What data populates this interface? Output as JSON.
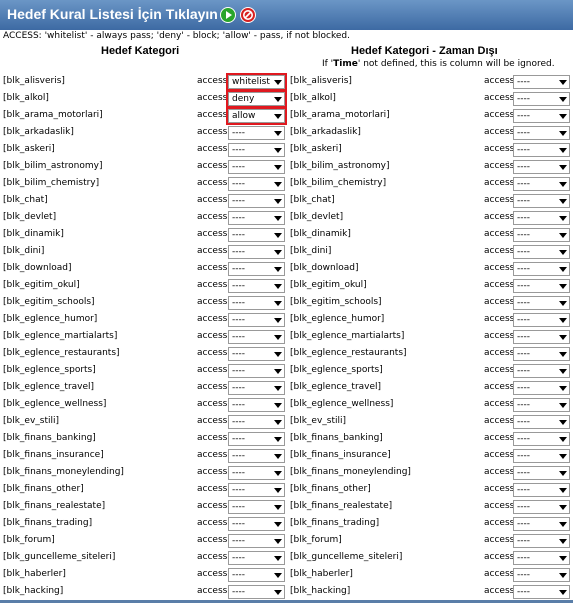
{
  "header": {
    "title": "Hedef Kural Listesi İçin Tıklayın",
    "play_icon": "play-icon",
    "stop_icon": "stop-icon",
    "accent": "#4a78b0"
  },
  "access_note": "ACCESS: 'whitelist' - always pass; 'deny' - block; 'allow' - pass, if not blocked.",
  "left_heading": "Hedef Kategori",
  "right_heading": "Hedef Kategori - Zaman Dışı",
  "right_note": {
    "prefix": "If '",
    "bold": "Time",
    "suffix": "' not defined, this is column will be ignored."
  },
  "access_label": "access",
  "rows": [
    {
      "cat": "[blk_alisveris]",
      "left_value": "whitelist",
      "right_value": "----"
    },
    {
      "cat": "[blk_alkol]",
      "left_value": "deny",
      "right_value": "----"
    },
    {
      "cat": "[blk_arama_motorlari]",
      "left_value": "allow",
      "right_value": "----"
    },
    {
      "cat": "[blk_arkadaslik]",
      "left_value": "----",
      "right_value": "----"
    },
    {
      "cat": "[blk_askeri]",
      "left_value": "----",
      "right_value": "----"
    },
    {
      "cat": "[blk_bilim_astronomy]",
      "left_value": "----",
      "right_value": "----"
    },
    {
      "cat": "[blk_bilim_chemistry]",
      "left_value": "----",
      "right_value": "----"
    },
    {
      "cat": "[blk_chat]",
      "left_value": "----",
      "right_value": "----"
    },
    {
      "cat": "[blk_devlet]",
      "left_value": "----",
      "right_value": "----"
    },
    {
      "cat": "[blk_dinamik]",
      "left_value": "----",
      "right_value": "----"
    },
    {
      "cat": "[blk_dini]",
      "left_value": "----",
      "right_value": "----"
    },
    {
      "cat": "[blk_download]",
      "left_value": "----",
      "right_value": "----"
    },
    {
      "cat": "[blk_egitim_okul]",
      "left_value": "----",
      "right_value": "----"
    },
    {
      "cat": "[blk_egitim_schools]",
      "left_value": "----",
      "right_value": "----"
    },
    {
      "cat": "[blk_eglence_humor]",
      "left_value": "----",
      "right_value": "----"
    },
    {
      "cat": "[blk_eglence_martialarts]",
      "left_value": "----",
      "right_value": "----"
    },
    {
      "cat": "[blk_eglence_restaurants]",
      "left_value": "----",
      "right_value": "----"
    },
    {
      "cat": "[blk_eglence_sports]",
      "left_value": "----",
      "right_value": "----"
    },
    {
      "cat": "[blk_eglence_travel]",
      "left_value": "----",
      "right_value": "----"
    },
    {
      "cat": "[blk_eglence_wellness]",
      "left_value": "----",
      "right_value": "----"
    },
    {
      "cat": "[blk_ev_stili]",
      "left_value": "----",
      "right_value": "----"
    },
    {
      "cat": "[blk_finans_banking]",
      "left_value": "----",
      "right_value": "----"
    },
    {
      "cat": "[blk_finans_insurance]",
      "left_value": "----",
      "right_value": "----"
    },
    {
      "cat": "[blk_finans_moneylending]",
      "left_value": "----",
      "right_value": "----"
    },
    {
      "cat": "[blk_finans_other]",
      "left_value": "----",
      "right_value": "----"
    },
    {
      "cat": "[blk_finans_realestate]",
      "left_value": "----",
      "right_value": "----"
    },
    {
      "cat": "[blk_finans_trading]",
      "left_value": "----",
      "right_value": "----"
    },
    {
      "cat": "[blk_forum]",
      "left_value": "----",
      "right_value": "----"
    },
    {
      "cat": "[blk_guncelleme_siteleri]",
      "left_value": "----",
      "right_value": "----"
    },
    {
      "cat": "[blk_haberler]",
      "left_value": "----",
      "right_value": "----"
    },
    {
      "cat": "[blk_hacking]",
      "left_value": "----",
      "right_value": "----"
    }
  ],
  "highlight_color": "#e0181f"
}
